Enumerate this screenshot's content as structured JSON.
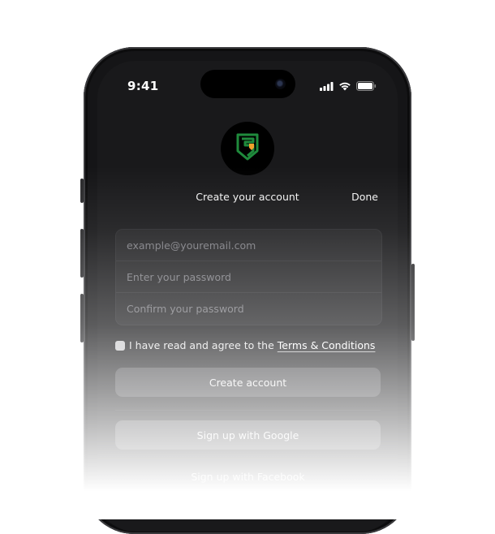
{
  "status_bar": {
    "time": "9:41"
  },
  "header": {
    "title": "Create your account",
    "done_label": "Done"
  },
  "form": {
    "email_placeholder": "example@youremail.com",
    "password_placeholder": "Enter your password",
    "confirm_placeholder": "Confirm your password"
  },
  "agreement": {
    "text": "I have read and agree to the",
    "link_label": "Terms & Conditions"
  },
  "actions": {
    "create_label": "Create account",
    "google_label": "Sign up with Google",
    "facebook_label": "Sign up with Facebook"
  },
  "colors": {
    "logo_green": "#1f8a3c",
    "logo_orange": "#f2a12b",
    "screen_bg": "#19191b"
  },
  "icons": [
    "signal-icon",
    "wifi-icon",
    "battery-icon",
    "shield-logo-icon"
  ]
}
